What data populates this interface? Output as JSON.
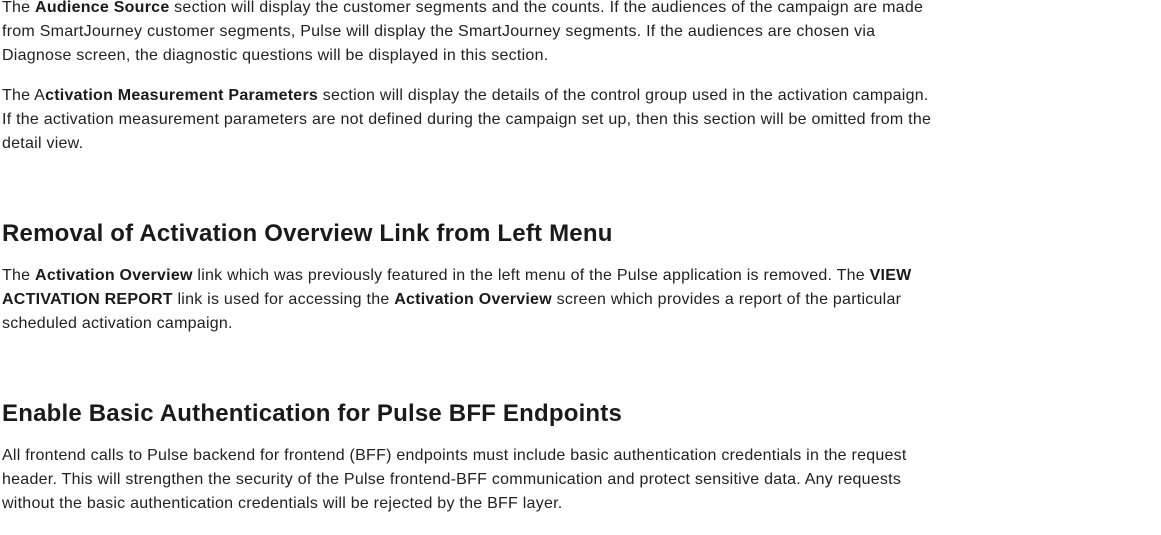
{
  "section_audience": {
    "prefix": "The ",
    "bold": "Audience Source",
    "rest": " section will display the customer segments and the counts. If the audiences of the campaign are made from SmartJourney customer segments, Pulse will display the SmartJourney segments. If the audiences are chosen via Diagnose screen, the diagnostic questions will be displayed in this section."
  },
  "section_activation_params": {
    "prefix": "The A",
    "bold": "ctivation Measurement Parameters",
    "rest": " section will display the details of the control group used in the activation campaign. If the activation measurement parameters are not defined during the campaign set up, then this section will be omitted from the detail view."
  },
  "removal": {
    "heading": "Removal of Activation Overview Link from Left Menu",
    "t1": "The ",
    "b1": "Activation Overview",
    "t2": " link which was previously featured in the left menu of the Pulse application is removed. The ",
    "b2": "VIEW ACTIVATION REPORT",
    "t3": " link is used for accessing the ",
    "b3": "Activation Overview",
    "t4": " screen which provides a report of the particular scheduled activation campaign."
  },
  "auth": {
    "heading": "Enable Basic Authentication for Pulse BFF Endpoints",
    "body": "All frontend calls to Pulse backend for frontend (BFF) endpoints must include basic authentication credentials in the request header. This will strengthen the security of the Pulse frontend-BFF communication and protect sensitive data. Any requests without the basic authentication credentials will be rejected by the BFF layer."
  }
}
